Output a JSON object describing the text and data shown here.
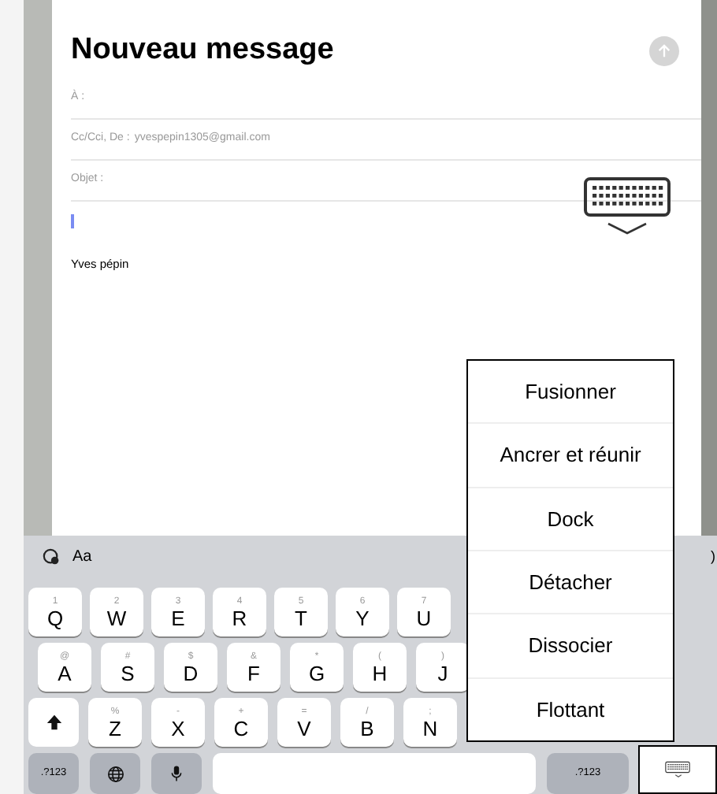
{
  "compose": {
    "title": "Nouveau message",
    "send_enabled": false,
    "fields": [
      {
        "label": "À :"
      },
      {
        "label": "Cc/Cci, De :",
        "value": "yvespepin1305@gmail.com"
      },
      {
        "label": "Objet :"
      }
    ],
    "signature": "Yves pépin"
  },
  "keyboard": {
    "suggestion": "Aa",
    "suggestion_edge": ")",
    "rows": [
      [
        {
          "main": "Q",
          "alt": "1"
        },
        {
          "main": "W",
          "alt": "2"
        },
        {
          "main": "E",
          "alt": "3"
        },
        {
          "main": "R",
          "alt": "4"
        },
        {
          "main": "T",
          "alt": "5"
        },
        {
          "main": "Y",
          "alt": "6"
        },
        {
          "main": "U",
          "alt": "7"
        }
      ],
      [
        {
          "main": "A",
          "alt": "@"
        },
        {
          "main": "S",
          "alt": "#"
        },
        {
          "main": "D",
          "alt": "$"
        },
        {
          "main": "F",
          "alt": "&"
        },
        {
          "main": "G",
          "alt": "*"
        },
        {
          "main": "H",
          "alt": "("
        },
        {
          "main": "J",
          "alt": ")"
        }
      ],
      [
        {
          "main": "Z",
          "alt": "%"
        },
        {
          "main": "X",
          "alt": "-"
        },
        {
          "main": "C",
          "alt": "+"
        },
        {
          "main": "V",
          "alt": "="
        },
        {
          "main": "B",
          "alt": "/"
        },
        {
          "main": "N",
          "alt": ";"
        }
      ]
    ],
    "numbers_key": ".?123",
    "numbers_key_right": ".?123"
  },
  "menu": {
    "items": [
      "Fusionner",
      "Ancrer et réunir",
      "Dock",
      "Détacher",
      "Dissocier",
      "Flottant"
    ]
  }
}
